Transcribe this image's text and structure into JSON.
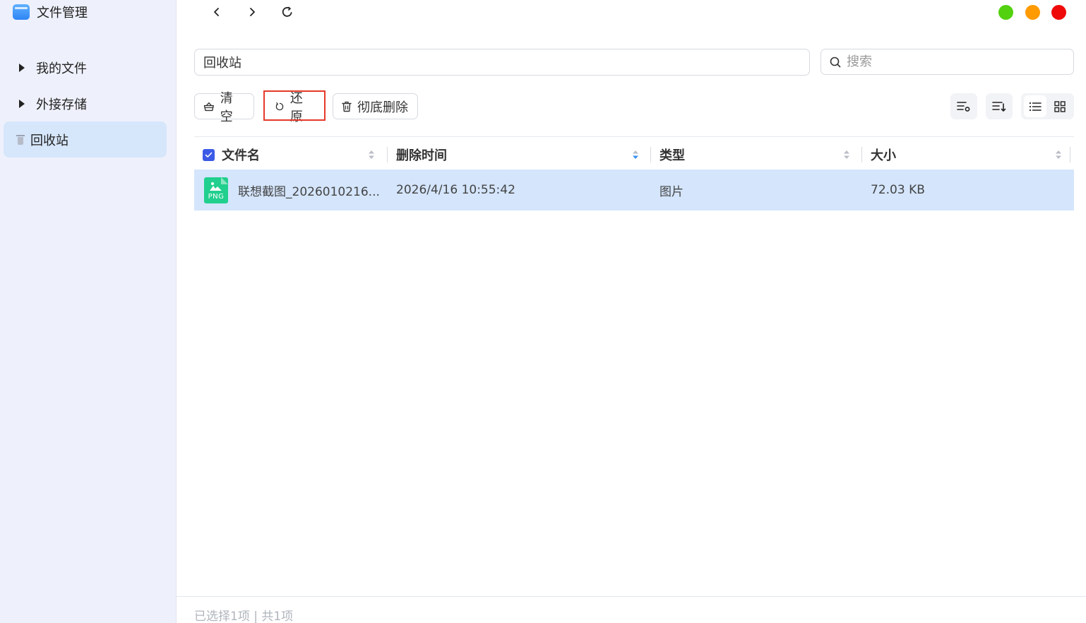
{
  "app": {
    "title": "文件管理"
  },
  "sidebar": {
    "items": [
      {
        "label": "我的文件"
      },
      {
        "label": "外接存储"
      },
      {
        "label": "回收站"
      }
    ]
  },
  "window_controls": {
    "colors": [
      "#52d10e",
      "#ff9a00",
      "#ef0a0a"
    ]
  },
  "path": {
    "value": "回收站"
  },
  "search": {
    "placeholder": "搜索"
  },
  "toolbar": {
    "clear_label": "清空",
    "restore_label": "还原",
    "delete_label": "彻底删除"
  },
  "table": {
    "columns": [
      "文件名",
      "删除时间",
      "类型",
      "大小"
    ],
    "rows": [
      {
        "icon_text": "PNG",
        "name": "联想截图_2026010216...",
        "deleted_at": "2026/4/16 10:55:42",
        "type": "图片",
        "size": "72.03 KB"
      }
    ]
  },
  "status": {
    "text": "已选择1项 | 共1项"
  },
  "colors": {
    "accent": "#3b5be6",
    "selected_row": "#d4e5fc",
    "highlight": "#e53a2a",
    "sidebar_bg": "#eef1fb"
  }
}
